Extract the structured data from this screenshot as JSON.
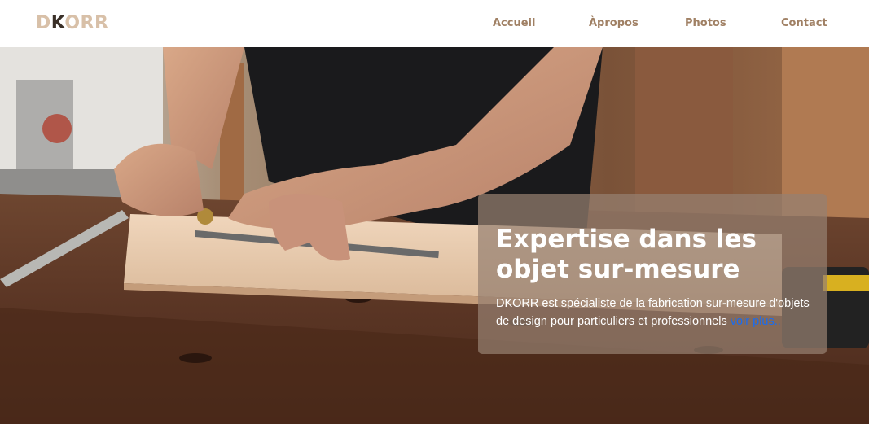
{
  "brand": {
    "logo_prefix": "D",
    "logo_accent": "K",
    "logo_suffix": "ORR",
    "primary_color": "#d8c0a8",
    "accent_color": "#3a3028"
  },
  "nav": {
    "items": [
      {
        "label": "Accueil"
      },
      {
        "label": "Àpropos"
      },
      {
        "label": "Photos"
      },
      {
        "label": "Contact"
      }
    ],
    "link_color": "#a08064"
  },
  "hero": {
    "image_description_icon": "woodworking-photo",
    "card": {
      "title": "Expertise dans les objet sur-mesure",
      "text": "DKORR est spécialiste de la fabrication sur-mesure d'objets de design pour particuliers et professionnels ",
      "link_label": "voir plus..",
      "link_color": "#1a6cf0"
    }
  }
}
